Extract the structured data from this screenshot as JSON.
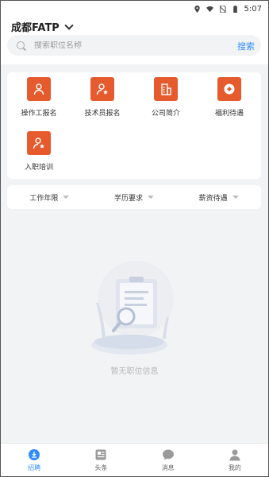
{
  "statusbar": {
    "time": "5:07"
  },
  "header": {
    "city": "成都FATP"
  },
  "search": {
    "placeholder": "搜索职位名称",
    "button_label": "搜索"
  },
  "menu": [
    {
      "label": "操作工报名",
      "icon": "person-icon"
    },
    {
      "label": "技术员报名",
      "icon": "person-star-icon"
    },
    {
      "label": "公司简介",
      "icon": "building-icon"
    },
    {
      "label": "福利待遇",
      "icon": "gift-icon"
    },
    {
      "label": "入职培训",
      "icon": "person-star-icon"
    }
  ],
  "filters": [
    {
      "label": "工作年限"
    },
    {
      "label": "学历要求"
    },
    {
      "label": "薪资待遇"
    }
  ],
  "empty_state": {
    "message": "暂无职位信息"
  },
  "tabs": [
    {
      "label": "招聘",
      "icon": "recruit-icon",
      "active": true
    },
    {
      "label": "头条",
      "icon": "news-icon",
      "active": false
    },
    {
      "label": "消息",
      "icon": "message-icon",
      "active": false
    },
    {
      "label": "我的",
      "icon": "profile-icon",
      "active": false
    }
  ],
  "colors": {
    "accent": "#2f8cff",
    "menu_icon_bg": "#e55b2d"
  }
}
